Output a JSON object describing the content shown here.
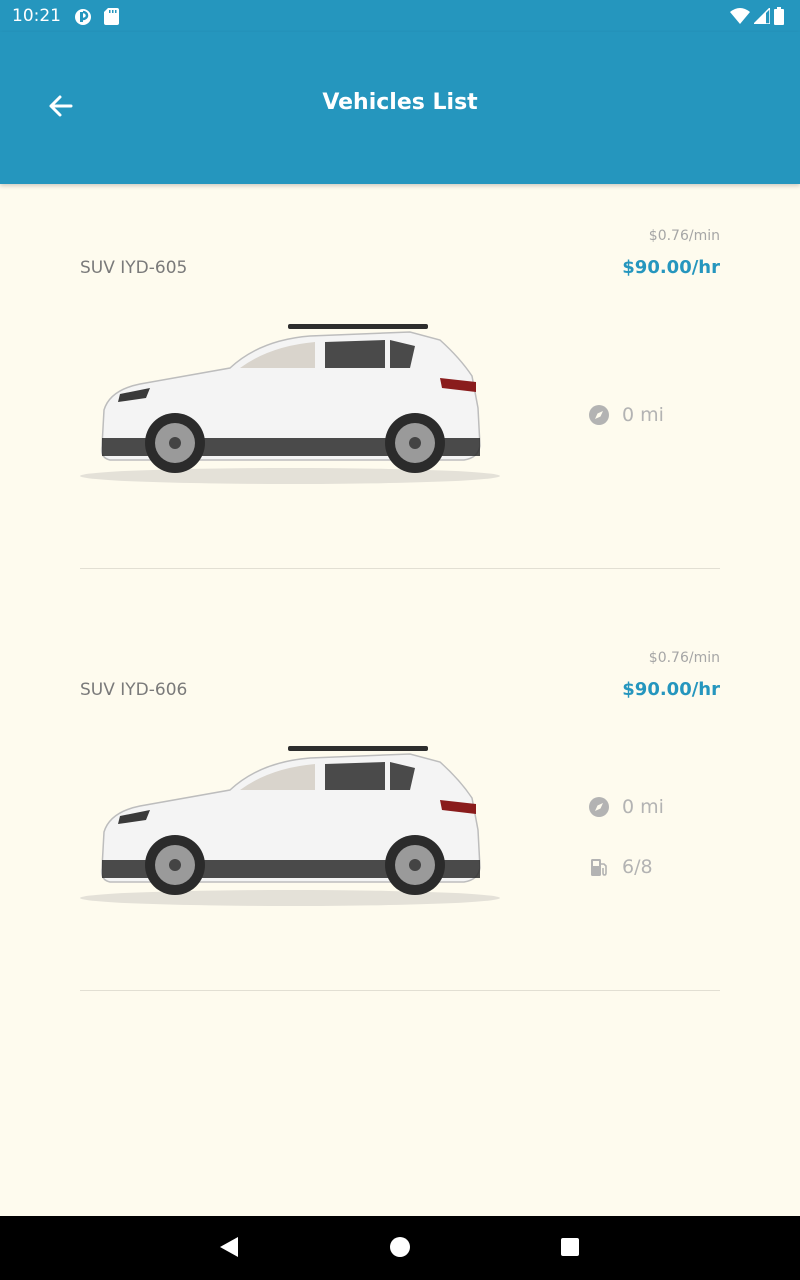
{
  "status_bar": {
    "time": "10:21"
  },
  "header": {
    "title": "Vehicles List"
  },
  "vehicles": [
    {
      "name": "SUV IYD-605",
      "rate_per_min": "$0.76/min",
      "rate_per_hr": "$90.00/hr",
      "distance": "0 mi"
    },
    {
      "name": "SUV IYD-606",
      "rate_per_min": "$0.76/min",
      "rate_per_hr": "$90.00/hr",
      "distance": "0 mi",
      "fuel": "6/8"
    }
  ],
  "colors": {
    "primary": "#2596be",
    "background": "#fefbee"
  },
  "icons": [
    "back-arrow-icon",
    "compass-icon",
    "fuel-pump-icon"
  ]
}
